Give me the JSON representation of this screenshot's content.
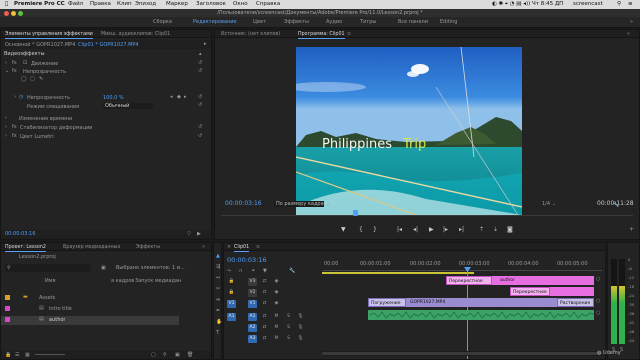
{
  "menubar": {
    "apple": "",
    "app": "Premiere Pro CC",
    "items": [
      "Файл",
      "Правка",
      "Клип",
      "Эпизод",
      "Маркер",
      "Заголовок",
      "Окно",
      "Справка"
    ],
    "clock": "Чт 8:45 ДП",
    "user": "screencast"
  },
  "titlebar": {
    "title": "/Пользователи/screencast/Документы/Adobe/Premiere Pro/11.0/Lesson2.prproj *"
  },
  "workspaces": [
    "Сборка",
    "Редактирование",
    "Цвет",
    "Эффекты",
    "Аудио",
    "Титры",
    "Все панели",
    "Editing"
  ],
  "workspace_active": "Редактирование",
  "effect_controls": {
    "tabs": [
      "Элементы управления эффектами",
      "Микш. аудиоклипов: Clip01"
    ],
    "source_label": "Основной * GOPR1027.MP4",
    "clip_label": "Clip01 * GOPR1027.MP4",
    "section": "Видеоэффекты",
    "rows": [
      {
        "label": "Движение"
      },
      {
        "label": "Непрозрачность"
      },
      {
        "label": "Непрозрачность",
        "value": "100,0 %"
      },
      {
        "label": "Режим смешивания",
        "value": "Обычный"
      },
      {
        "label": "Изменение времени"
      },
      {
        "label": "Стабилизатор деформации"
      },
      {
        "label": "Цвет Lumetri"
      }
    ]
  },
  "source_monitor": {
    "tab": "Источник: (нет клипов)"
  },
  "program_monitor": {
    "tab": "Программа: Clip01",
    "overlay_title_1": "Philippines",
    "overlay_title_2": "Trip",
    "timecode": "00:00:03:16",
    "fit": "По размеру кадра",
    "fraction": "1/4",
    "duration": "00:00:11:28",
    "playhead_fraction": 0.32
  },
  "project": {
    "tabs": [
      "Проект: Lesson2",
      "Браузер медиаданных",
      "Эффекты"
    ],
    "file": "Lesson2.prproj",
    "selected_info": "Выбрано элементов: 1 и...",
    "col_name": "Имя",
    "col_start": "Запуск медиадан",
    "col_fps": "а кадров",
    "items": [
      {
        "name": "Assets",
        "color": "#d8a02a",
        "type": "folder"
      },
      {
        "name": "intro title",
        "color": "#d847c8",
        "type": "item"
      },
      {
        "name": "author",
        "color": "#d847c8",
        "type": "item"
      }
    ]
  },
  "timeline": {
    "tab": "Clip01",
    "timecode": "00:00:03:16",
    "ruler": [
      "00:00",
      "00:00:01:00",
      "00:00:02:00",
      "00:00:03:00",
      "00:00:04:00",
      "00:00:05:00"
    ],
    "tracks": [
      "V3",
      "V2",
      "V1",
      "A1",
      "A2",
      "A3"
    ],
    "src_patch_v": "V1",
    "src_patch_a": "A1",
    "clips": {
      "v3_a": "Перекрестное",
      "v3_b": "author",
      "v2_a": "Перекрестное",
      "v1_a": "Погружение",
      "v1_b": "GOPR1027.MP4",
      "v1_c": "Растворение"
    }
  },
  "audio_meter": {
    "labels": [
      "0",
      "-6",
      "-12",
      "-18",
      "-24",
      "-30",
      "-36",
      "-42",
      "-48",
      "-54"
    ],
    "bottom": [
      "S",
      "S"
    ]
  },
  "watermark": "Udemy",
  "colors": {
    "accent": "#4f9ef5",
    "video_clip": "#9b8bd0",
    "title_clip": "#e76ee1",
    "audio_clip": "#3aa365"
  }
}
